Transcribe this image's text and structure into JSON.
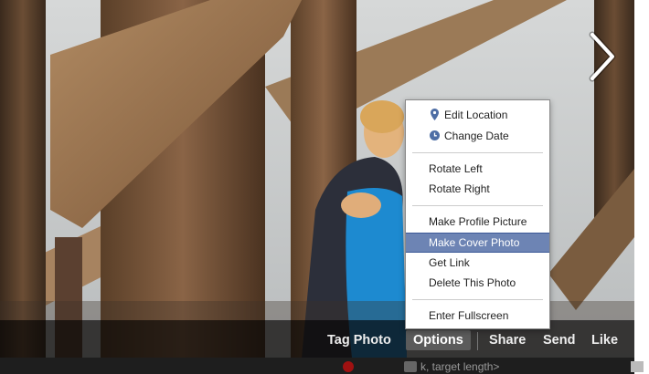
{
  "photo_viewer": {
    "options_menu": {
      "items": [
        {
          "label": "Edit Location",
          "icon": "map-pin-icon"
        },
        {
          "label": "Change Date",
          "icon": "clock-icon"
        },
        {
          "label": "Rotate Left"
        },
        {
          "label": "Rotate Right"
        },
        {
          "label": "Make Profile Picture"
        },
        {
          "label": "Make Cover Photo",
          "highlighted": true
        },
        {
          "label": "Get Link"
        },
        {
          "label": "Delete This Photo"
        },
        {
          "label": "Enter Fullscreen"
        }
      ]
    },
    "action_bar": {
      "tag_photo": "Tag Photo",
      "options": "Options",
      "share": "Share",
      "send": "Send",
      "like": "Like"
    },
    "next_icon": "chevron-right-icon",
    "below_text": "k, target length>"
  },
  "colors": {
    "menu_highlight": "#6d84b4",
    "menu_highlight_border": "#3b5998",
    "icon_blue": "#4e6ea5"
  }
}
